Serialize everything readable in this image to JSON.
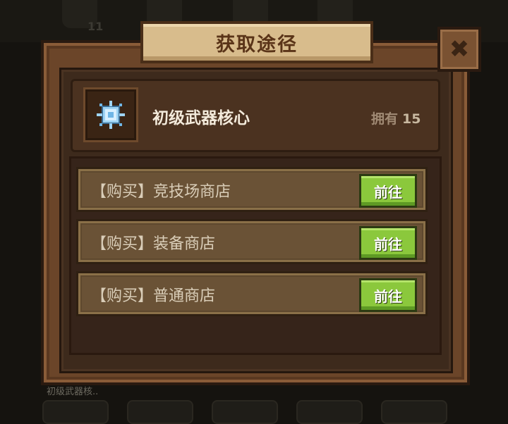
{
  "background": {
    "count": "11",
    "caption": "初级武器核.."
  },
  "dialog": {
    "title": "获取途径",
    "close_icon": "close-x-icon"
  },
  "item": {
    "icon": "weapon-core-crystal-icon",
    "name": "初级武器核心",
    "own_label": "拥有",
    "own_count": "15"
  },
  "sources": [
    {
      "label": "【购买】竞技场商店",
      "button": "前往"
    },
    {
      "label": "【购买】装备商店",
      "button": "前往"
    },
    {
      "label": "【购买】普通商店",
      "button": "前往"
    }
  ],
  "colors": {
    "go_button": "#8bc83c",
    "frame": "#6b4529",
    "title_tab": "#d8bc8c"
  }
}
